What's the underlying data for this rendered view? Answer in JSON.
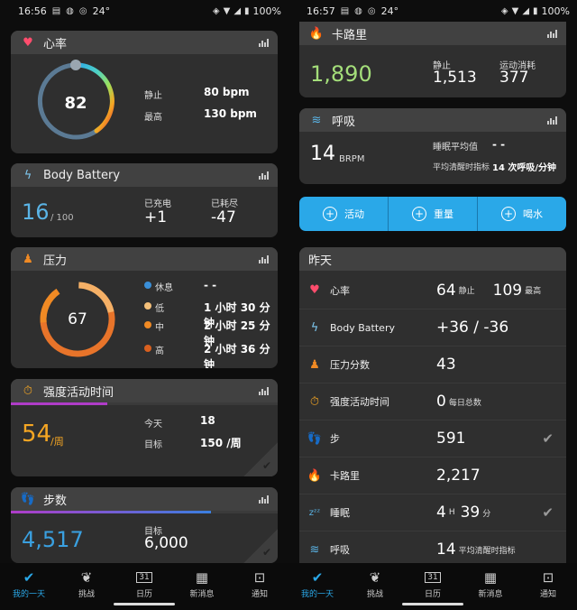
{
  "left": {
    "status": {
      "time": "16:56",
      "temp": "24°",
      "battery": "100%"
    },
    "heart": {
      "title": "心率",
      "value": "82",
      "resting_label": "静止",
      "resting_value": "80 bpm",
      "max_label": "最高",
      "max_value": "130 bpm"
    },
    "battery": {
      "title": "Body Battery",
      "value": "16",
      "max": "/ 100",
      "charged_label": "已充电",
      "charged_value": "+1",
      "drained_label": "已耗尽",
      "drained_value": "-47"
    },
    "stress": {
      "title": "压力",
      "value": "67",
      "rest_label": "休息",
      "rest_value": "- -",
      "low_label": "低",
      "low_value": "1 小时 30 分钟",
      "mid_label": "中",
      "mid_value": "2 小时 25 分钟",
      "high_label": "高",
      "high_value": "2 小时 36 分钟"
    },
    "intensity": {
      "title": "强度活动时间",
      "value": "54",
      "unit": "/周",
      "today_label": "今天",
      "today_value": "18",
      "goal_label": "目标",
      "goal_value": "150 /周",
      "progress": 0.36
    },
    "steps": {
      "title": "步数",
      "value": "4,517",
      "goal_label": "目标",
      "goal_value": "6,000",
      "progress": 0.75
    }
  },
  "right": {
    "status": {
      "time": "16:57",
      "temp": "24°",
      "battery": "100%"
    },
    "calories": {
      "title": "卡路里",
      "value": "1,890",
      "rest_label": "静止",
      "rest_value": "1,513",
      "active_label": "运动消耗",
      "active_value": "377"
    },
    "respiration": {
      "title": "呼吸",
      "value": "14",
      "unit": "BRPM",
      "sleep_label": "睡眠平均值",
      "sleep_value": "- -",
      "awake_label": "平均清醒时指标",
      "awake_value": "14 次呼吸/分钟"
    },
    "actions": {
      "activity": "活动",
      "weight": "重量",
      "water": "喝水"
    },
    "yesterday": {
      "title": "昨天",
      "rows": [
        {
          "name": "心率",
          "value": "64",
          "sub": "静止",
          "value2": "109",
          "sub2": "最高",
          "check": false
        },
        {
          "name": "Body Battery",
          "value": "+36 / -36",
          "sub": "",
          "check": false
        },
        {
          "name": "压力分数",
          "value": "43",
          "sub": "",
          "check": false
        },
        {
          "name": "强度活动时间",
          "value": "0",
          "sub": "每日总数",
          "check": false
        },
        {
          "name": "步",
          "value": "591",
          "sub": "",
          "check": true
        },
        {
          "name": "卡路里",
          "value": "2,217",
          "sub": "",
          "check": false
        },
        {
          "name": "睡眠",
          "value": "4",
          "sub": "H",
          "value2": "39",
          "sub2": "分",
          "check": true
        },
        {
          "name": "呼吸",
          "value": "14",
          "sub": "平均清醒时指标",
          "check": false
        }
      ]
    }
  },
  "nav": {
    "my_day": "我的一天",
    "challenges": "挑战",
    "calendar": "日历",
    "calendar_day": "31",
    "news": "新消息",
    "notifications": "通知"
  },
  "colors": {
    "accent_blue": "#2aa8e8",
    "stress_orange": "#f08a24",
    "calorie_green": "#a4de7a",
    "intensity_orange": "#f5a623",
    "steps_blue": "#3aa0e0",
    "heart_pink": "#ff4d6d"
  }
}
